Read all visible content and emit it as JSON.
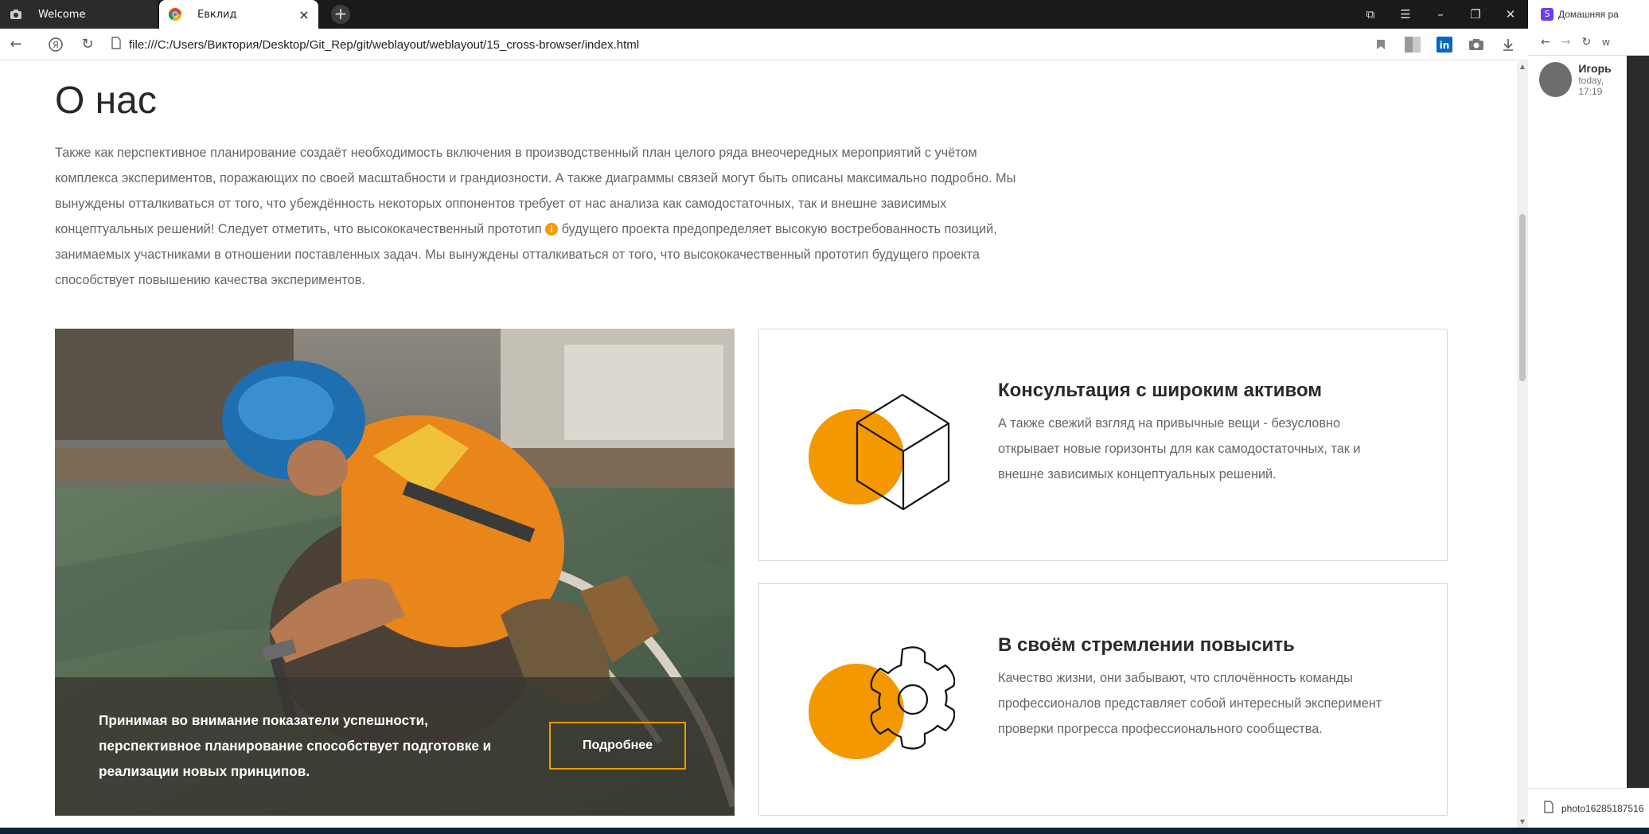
{
  "browser": {
    "tabs": [
      {
        "title": "Welcome",
        "active": false
      },
      {
        "title": "Евклид",
        "active": true
      }
    ],
    "url": "file:///C:/Users/Виктория/Desktop/Git_Rep/git/weblayout/weblayout/15_cross-browser/index.html"
  },
  "page": {
    "title": "О нас",
    "intro_part1": "Также как перспективное планирование создаёт необходимость включения в производственный план целого ряда внеочередных мероприятий с учётом комплекса экспериментов, поражающих по своей масштабности и грандиозности. А также диаграммы связей могут быть описаны максимально подробно. Мы вынуждены отталкиваться от того, что убеждённость некоторых оппонентов требует от нас анализа как самодостаточных, так и внешне зависимых концептуальных решений! Следует отметить, что высококачественный прототип",
    "intro_part2": "будущего проекта предопределяет высокую востребованность позиций, занимаемых участниками в отношении поставленных задач. Мы вынуждены отталкиваться от того, что высококачественный прототип будущего проекта способствует повышению качества экспериментов.",
    "info_icon": "i",
    "photo_card": {
      "text": "Принимая во внимание показатели успешности, перспективное планирование способствует подготовке и реализации новых принципов.",
      "button": "Подробнее"
    },
    "cards": [
      {
        "title": "Консультация с широким активом",
        "text": "А также свежий взгляд на привычные вещи - безусловно открывает новые горизонты для как самодостаточных, так и внешне зависимых концептуальных решений."
      },
      {
        "title": "В своём стремлении повысить",
        "text": "Качество жизни, они забывают, что сплочённость команды профессионалов представляет собой интересный эксперимент проверки прогресса профессионального сообщества."
      }
    ]
  },
  "side_window": {
    "tab_title": "Домашняя ра",
    "address_partial": "w",
    "chat_user": "Игорь",
    "chat_time": "today, 17:19",
    "download": "photo16285187516"
  },
  "colors": {
    "accent": "#f39800"
  }
}
